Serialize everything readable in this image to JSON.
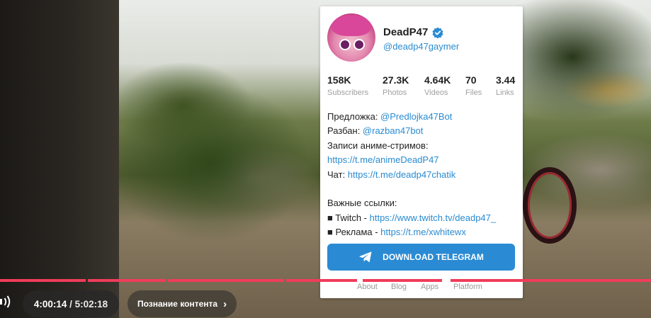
{
  "channel": {
    "name": "DeadP47",
    "handle": "@deadp47gaymer",
    "stats": [
      {
        "value": "158K",
        "label": "Subscribers"
      },
      {
        "value": "27.3K",
        "label": "Photos"
      },
      {
        "value": "4.64K",
        "label": "Videos"
      },
      {
        "value": "70",
        "label": "Files"
      },
      {
        "value": "3.44",
        "label": "Links"
      }
    ],
    "description": {
      "l1_text": "Предложка: ",
      "l1_link": "@Predlojka47Bot",
      "l2_text": "Разбан: ",
      "l2_link": "@razban47bot",
      "l3_text": "Записи аниме-стримов:",
      "l4_link": "https://t.me/animeDeadP47",
      "l5_text": "Чат: ",
      "l5_link": "https://t.me/deadp47chatik",
      "l6_text": "Важные ссылки:",
      "l7_text": "■ Twitch - ",
      "l7_link": "https://www.twitch.tv/deadp47_",
      "l8_text": "■ Реклама - ",
      "l8_link": "https://t.me/xwhitewx"
    },
    "download_button": "DOWNLOAD TELEGRAM",
    "footer": [
      "About",
      "Blog",
      "Apps",
      "Platform"
    ]
  },
  "player": {
    "current_time": "4:00:14",
    "separator": " / ",
    "duration": "5:02:18",
    "chapter_label": "Познание контента",
    "chapter_chevron": "›"
  },
  "colors": {
    "accent": "#2a8bd4",
    "link": "#2a8bd0",
    "progress": "#f03c5a"
  },
  "icons": [
    "verified-badge-icon",
    "telegram-plane-icon",
    "volume-icon",
    "chevron-right-icon"
  ]
}
